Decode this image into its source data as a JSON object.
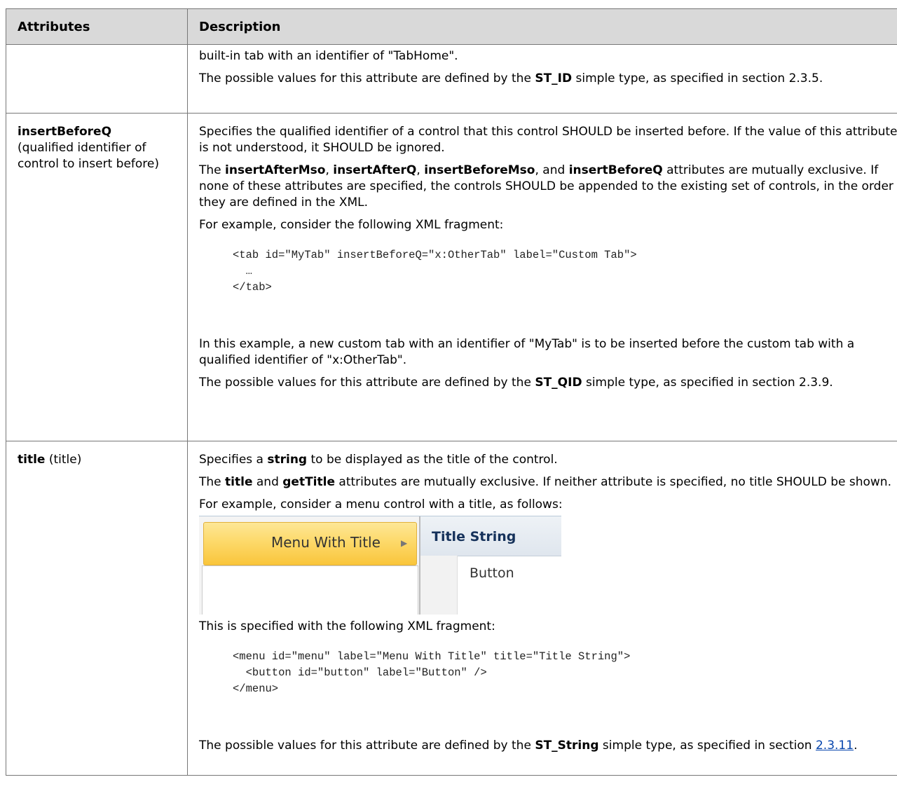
{
  "table": {
    "headers": [
      "Attributes",
      "Description"
    ],
    "row0": {
      "desc_line1": "built-in tab with an identifier of \"TabHome\".",
      "desc_line2_pre": "The possible values for this attribute are defined by the ",
      "desc_line2_bold": "ST_ID",
      "desc_line2_post": " simple type, as specified in section 2.3.5."
    },
    "row1": {
      "attr_name": "insertBeforeQ",
      "attr_desc": "(qualified identifier of control to insert before)",
      "p1": "Specifies the qualified identifier of a control that this control SHOULD be inserted before. If the value of this attribute is not understood, it SHOULD be ignored.",
      "p2_pre": "The ",
      "p2_b1": "insertAfterMso",
      "p2_s1": ", ",
      "p2_b2": "insertAfterQ",
      "p2_s2": ", ",
      "p2_b3": "insertBeforeMso",
      "p2_s3": ", and ",
      "p2_b4": "insertBeforeQ",
      "p2_post": " attributes are mutually exclusive. If none of these attributes are specified, the controls SHOULD be appended to the existing set of controls, in the order they are defined in the XML.",
      "p3": "For example, consider the following XML fragment:",
      "code": "<tab id=\"MyTab\" insertBeforeQ=\"x:OtherTab\" label=\"Custom Tab\">\n  …\n</tab>",
      "p4": "In this example, a new custom tab with an identifier of \"MyTab\" is to be inserted before the custom tab with a qualified identifier of \"x:OtherTab\".",
      "p5_pre": "The possible values for this attribute are defined by the ",
      "p5_bold": "ST_QID",
      "p5_post": " simple type, as specified in section 2.3.9."
    },
    "row2": {
      "attr_name": "title",
      "attr_desc": " (title)",
      "p1_pre": "Specifies a ",
      "p1_bold": "string",
      "p1_post": " to be displayed as the title of the control.",
      "p2_pre": "The ",
      "p2_b1": "title",
      "p2_mid": " and ",
      "p2_b2": "getTitle",
      "p2_post": " attributes are mutually exclusive. If neither attribute is specified, no title SHOULD be shown.",
      "p3": "For example, consider a menu control with a title, as follows:",
      "shot": {
        "menu_label": "Menu With Title",
        "arrow": "▶",
        "title_string": "Title String",
        "button_label": "Button"
      },
      "p4": "This is specified with the following XML fragment:",
      "code": "<menu id=\"menu\" label=\"Menu With Title\" title=\"Title String\">\n  <button id=\"button\" label=\"Button\" />\n</menu>",
      "p5_pre": "The possible values for this attribute are defined by the ",
      "p5_bold": "ST_String",
      "p5_mid": " simple type, as specified in section ",
      "p5_link": "2.3.11",
      "p5_post": "."
    }
  }
}
